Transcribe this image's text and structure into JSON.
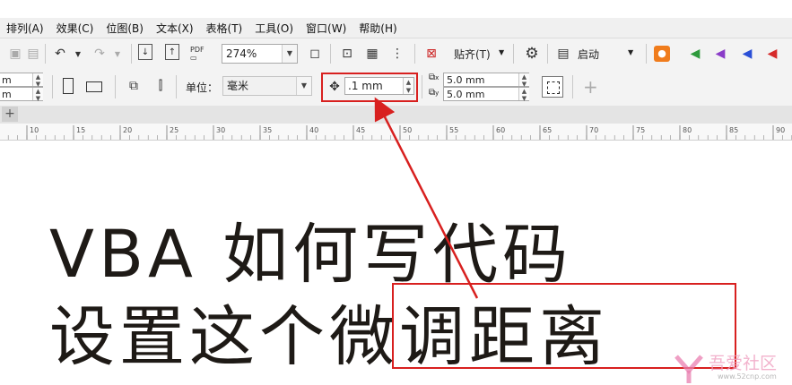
{
  "menu": [
    "排列(A)",
    "效果(C)",
    "位图(B)",
    "文本(X)",
    "表格(T)",
    "工具(O)",
    "窗口(W)",
    "帮助(H)"
  ],
  "toolbar": {
    "pdf_label": "PDF",
    "zoom_value": "274%",
    "snap_label": "贴齐(T)",
    "launch_label": "启动"
  },
  "property_bar": {
    "size_w_suffix": "m",
    "size_h_suffix": "m",
    "units_label": "单位：",
    "units_value": "毫米",
    "nudge_value": ".1 mm",
    "dup_x_value": "5.0 mm",
    "dup_y_value": "5.0 mm",
    "dup_x_sub": "x",
    "dup_y_sub": "y"
  },
  "ruler": {
    "ticks": [
      "10",
      "15",
      "20",
      "25",
      "30",
      "35",
      "40",
      "45",
      "50",
      "55",
      "60",
      "65",
      "70",
      "75",
      "80",
      "85",
      "90"
    ]
  },
  "canvas": {
    "line1": "VBA 如何写代码",
    "line2": "设置这个微调距离"
  },
  "watermark": {
    "name": "吾爱社区",
    "url": "www.52cnp.com"
  },
  "colors": {
    "highlight": "#d8201f",
    "text": "#1e1a16"
  }
}
